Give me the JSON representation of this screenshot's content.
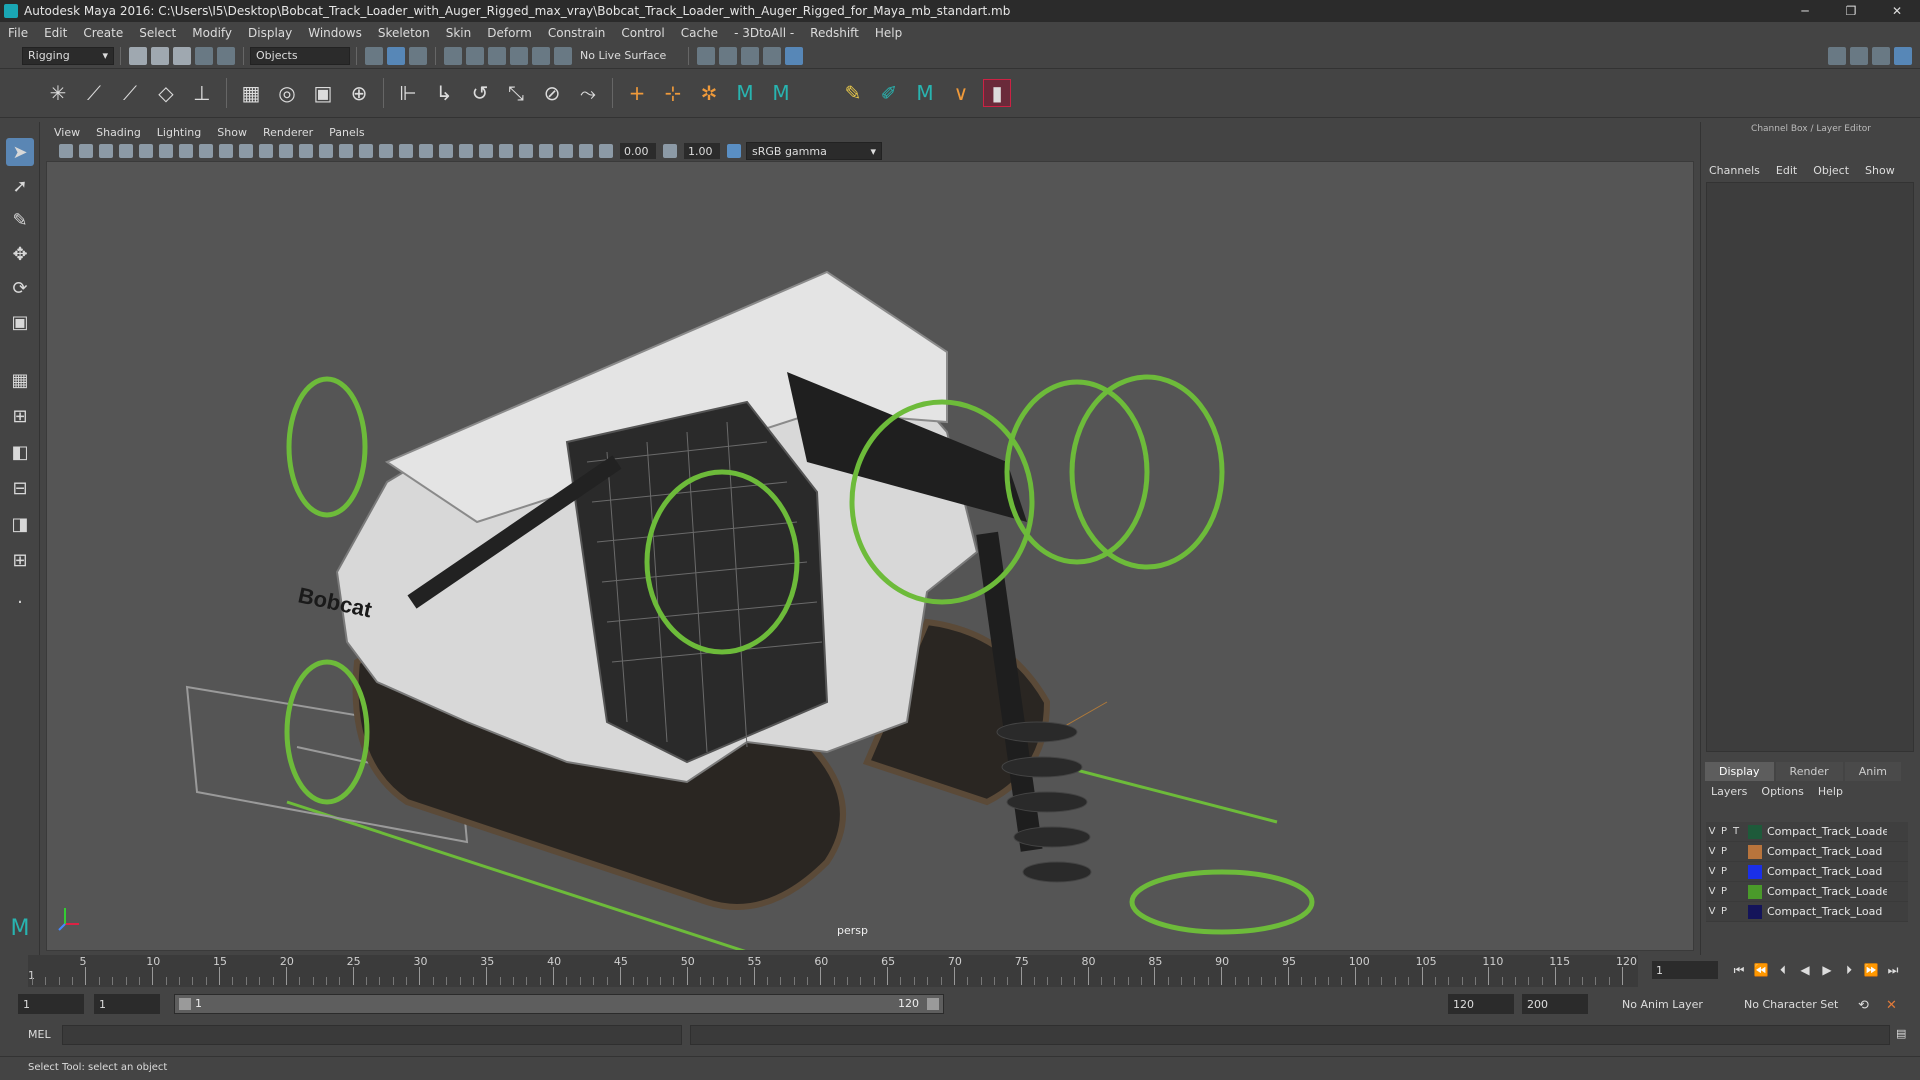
{
  "window": {
    "title": "Autodesk Maya 2016: C:\\Users\\I5\\Desktop\\Bobcat_Track_Loader_with_Auger_Rigged_max_vray\\Bobcat_Track_Loader_with_Auger_Rigged_for_Maya_mb_standart.mb",
    "minimize": "─",
    "maximize": "❐",
    "close": "✕"
  },
  "menubar": [
    "File",
    "Edit",
    "Create",
    "Select",
    "Modify",
    "Display",
    "Windows",
    "Skeleton",
    "Skin",
    "Deform",
    "Constrain",
    "Control",
    "Cache",
    "- 3DtoAll -",
    "Redshift",
    "Help"
  ],
  "statusline": {
    "menuset": "Rigging",
    "selection_mask": "Objects",
    "live_surface": "No Live Surface"
  },
  "panel": {
    "menu": [
      "View",
      "Shading",
      "Lighting",
      "Show",
      "Renderer",
      "Panels"
    ],
    "near_value": "0.00",
    "far_value": "1.00",
    "color_space": "sRGB gamma",
    "camera_label": "persp"
  },
  "viewport_text": {
    "brand_side": "Bobcat"
  },
  "channel_box": {
    "title": "Channel Box / Layer Editor",
    "menu": [
      "Channels",
      "Edit",
      "Object",
      "Show"
    ]
  },
  "layer_editor": {
    "tabs": [
      "Display",
      "Render",
      "Anim"
    ],
    "menu": [
      "Layers",
      "Options",
      "Help"
    ],
    "layers": [
      {
        "v": "V",
        "p": "P",
        "t": "T",
        "name": "Compact_Track_Loader_Bo",
        "color": "#1e5a3a"
      },
      {
        "v": "V",
        "p": "P",
        "t": "",
        "name": "Compact_Track_Load",
        "color": "#b8743c"
      },
      {
        "v": "V",
        "p": "P",
        "t": "",
        "name": "Compact_Track_Load",
        "color": "#1a2fe8"
      },
      {
        "v": "V",
        "p": "P",
        "t": "",
        "name": "Compact_Track_Loader_",
        "color": "#4a9a2a"
      },
      {
        "v": "V",
        "p": "P",
        "t": "",
        "name": "Compact_Track_Load",
        "color": "#14145a"
      }
    ]
  },
  "timeline": {
    "ticks": [
      "5",
      "10",
      "15",
      "20",
      "25",
      "30",
      "35",
      "40",
      "45",
      "50",
      "55",
      "60",
      "65",
      "70",
      "75",
      "80",
      "85",
      "90",
      "95",
      "100",
      "105",
      "110",
      "115",
      "120"
    ],
    "start_marker": "1",
    "current_frame": "1"
  },
  "range": {
    "start_field": "1",
    "start_field2": "1",
    "range_start": "1",
    "range_end": "120",
    "end_field": "120",
    "end_field2": "200",
    "anim_layer": "No Anim Layer",
    "character_set": "No Character Set"
  },
  "command": {
    "language": "MEL"
  },
  "help_line": "Select Tool: select an object",
  "colors": {
    "rig_control": "#6dbb3a",
    "viewport_bg": "#555555",
    "ui_bg": "#444444"
  }
}
